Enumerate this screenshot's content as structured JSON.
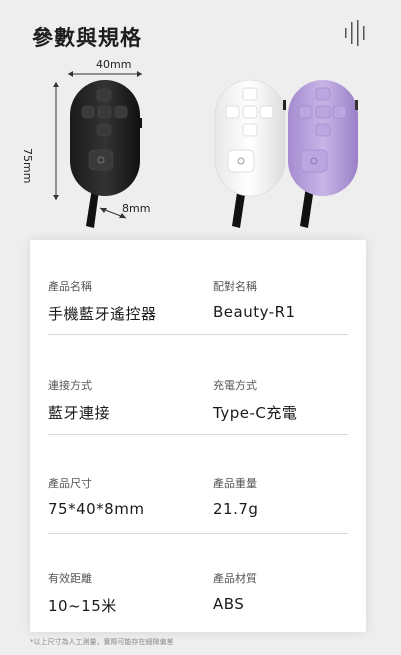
{
  "header": {
    "title": "參數與規格"
  },
  "dimensions": {
    "width": "40mm",
    "height": "75mm",
    "thickness": "8mm"
  },
  "colors": {
    "device_black": "#262626",
    "device_white": "#f7f7f7",
    "device_purple": "#b9a3db"
  },
  "specs": [
    {
      "left_label": "產品名稱",
      "left_value": "手機藍牙遙控器",
      "right_label": "配對名稱",
      "right_value": "Beauty-R1"
    },
    {
      "left_label": "連接方式",
      "left_value": "藍牙連接",
      "right_label": "充電方式",
      "right_value": "Type-C充電"
    },
    {
      "left_label": "產品尺寸",
      "left_value": "75*40*8mm",
      "right_label": "產品重量",
      "right_value": "21.7g"
    },
    {
      "left_label": "有效距離",
      "left_value": "10~15米",
      "right_label": "產品材質",
      "right_value": "ABS"
    }
  ],
  "footnote": "*以上尺寸為人工測量，實際可能存在細微偏差"
}
